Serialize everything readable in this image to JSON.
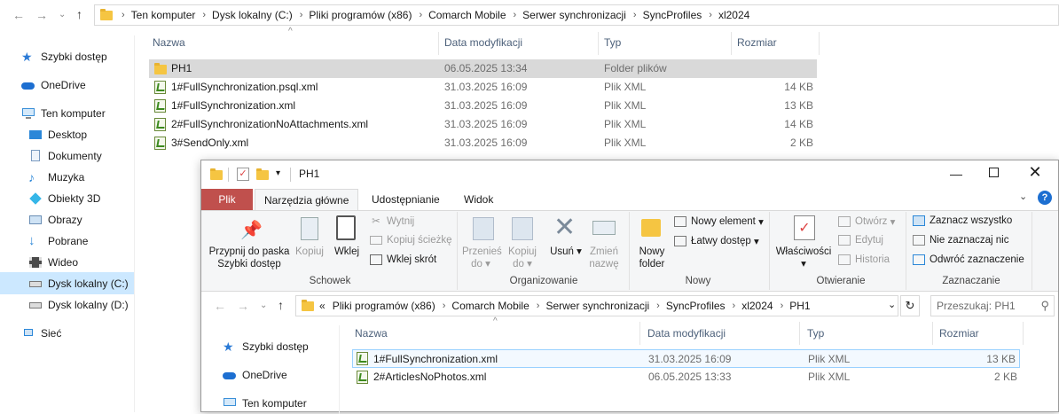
{
  "back_window": {
    "breadcrumbs": [
      "Ten komputer",
      "Dysk lokalny (C:)",
      "Pliki programów (x86)",
      "Comarch Mobile",
      "Serwer synchronizacji",
      "SyncProfiles",
      "xl2024"
    ],
    "columns": {
      "name": "Nazwa",
      "date": "Data modyfikacji",
      "type": "Typ",
      "size": "Rozmiar"
    },
    "files": [
      {
        "name": "PH1",
        "date": "06.05.2025 13:34",
        "type": "Folder plików",
        "size": "",
        "icon": "folder-icon"
      },
      {
        "name": "1#FullSynchronization.psql.xml",
        "date": "31.03.2025 16:09",
        "type": "Plik XML",
        "size": "14 KB",
        "icon": "xml-file-icon"
      },
      {
        "name": "1#FullSynchronization.xml",
        "date": "31.03.2025 16:09",
        "type": "Plik XML",
        "size": "13 KB",
        "icon": "xml-file-icon"
      },
      {
        "name": "2#FullSynchronizationNoAttachments.xml",
        "date": "31.03.2025 16:09",
        "type": "Plik XML",
        "size": "14 KB",
        "icon": "xml-file-icon"
      },
      {
        "name": "3#SendOnly.xml",
        "date": "31.03.2025 16:09",
        "type": "Plik XML",
        "size": "2 KB",
        "icon": "xml-file-icon"
      }
    ],
    "sidebar": [
      "Szybki dostęp",
      "OneDrive",
      "Ten komputer",
      "Desktop",
      "Dokumenty",
      "Muzyka",
      "Obiekty 3D",
      "Obrazy",
      "Pobrane",
      "Wideo",
      "Dysk lokalny (C:)",
      "Dysk lokalny (D:)",
      "Sieć"
    ]
  },
  "front_window": {
    "title": "PH1",
    "tabs": [
      "Plik",
      "Narzędzia główne",
      "Udostępnianie",
      "Widok"
    ],
    "ribbon": {
      "pin": "Przypnij do paska Szybki dostęp",
      "copy": "Kopiuj",
      "paste": "Wklej",
      "cut": "Wytnij",
      "copy_path": "Kopiuj ścieżkę",
      "paste_shortcut": "Wklej skrót",
      "clipboard_group": "Schowek",
      "move_to": "Przenieś do",
      "copy_to": "Kopiuj do",
      "delete": "Usuń",
      "rename": "Zmień nazwę",
      "organize_group": "Organizowanie",
      "new_folder": "Nowy folder",
      "new_item": "Nowy element",
      "easy_access": "Łatwy dostęp",
      "new_group": "Nowy",
      "properties": "Właściwości",
      "open": "Otwórz",
      "edit": "Edytuj",
      "history": "Historia",
      "open_group": "Otwieranie",
      "select_all": "Zaznacz wszystko",
      "select_none": "Nie zaznaczaj nic",
      "invert": "Odwróć zaznaczenie",
      "select_group": "Zaznaczanie"
    },
    "breadcrumbs": [
      "Pliki programów (x86)",
      "Comarch Mobile",
      "Serwer synchronizacji",
      "SyncProfiles",
      "xl2024",
      "PH1"
    ],
    "breadcrumb_overflow": "«",
    "search_placeholder": "Przeszukaj: PH1",
    "columns": {
      "name": "Nazwa",
      "date": "Data modyfikacji",
      "type": "Typ",
      "size": "Rozmiar"
    },
    "files": [
      {
        "name": "1#FullSynchronization.xml",
        "date": "31.03.2025 16:09",
        "type": "Plik XML",
        "size": "13 KB"
      },
      {
        "name": "2#ArticlesNoPhotos.xml",
        "date": "06.05.2025 13:33",
        "type": "Plik XML",
        "size": "2 KB"
      }
    ],
    "sidebar": [
      "Szybki dostęp",
      "OneDrive",
      "Ten komputer"
    ]
  }
}
